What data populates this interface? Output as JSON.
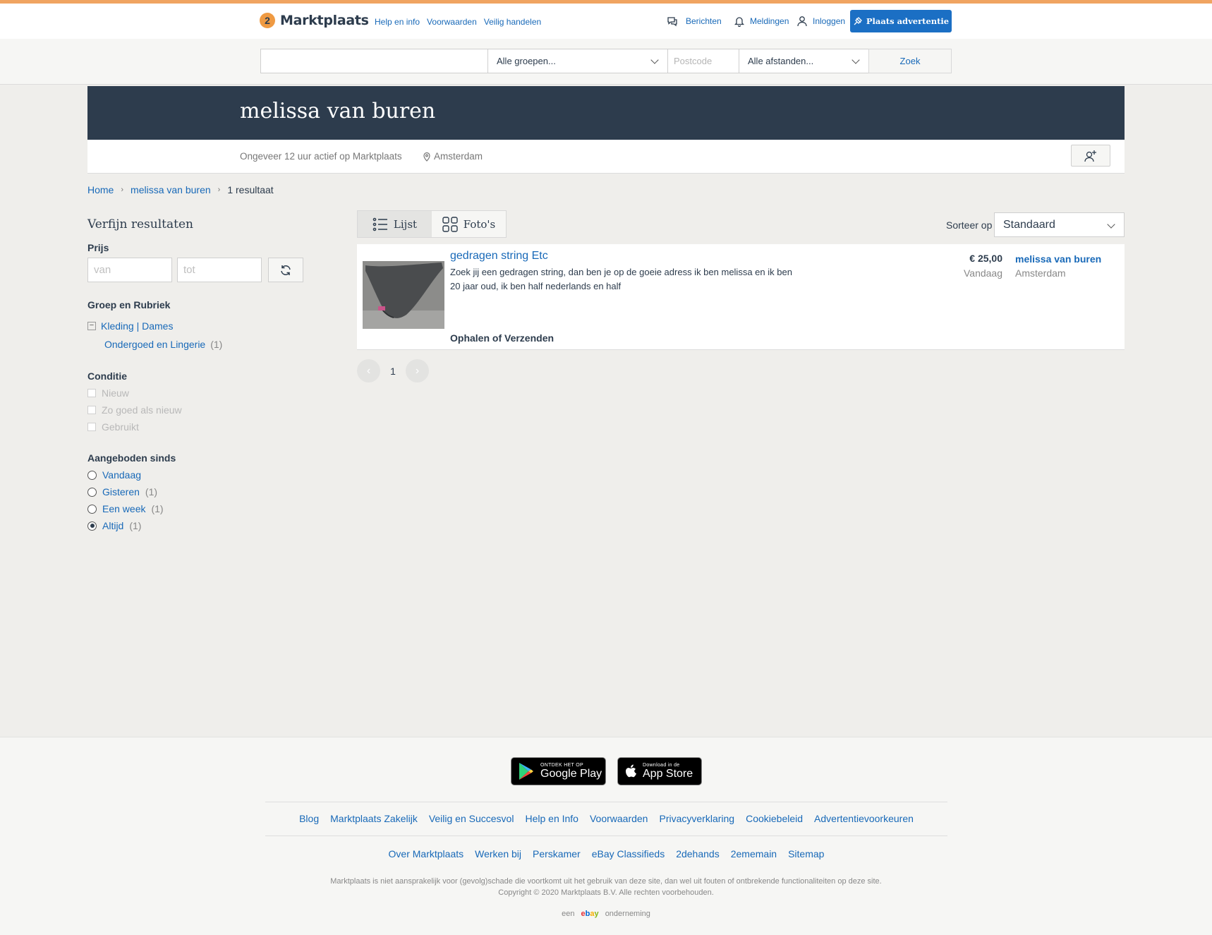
{
  "header": {
    "logo_text": "Marktplaats",
    "nav": [
      "Help en info",
      "Voorwaarden",
      "Veilig handelen"
    ],
    "berichten": "Berichten",
    "meldingen": "Meldingen",
    "inloggen": "Inloggen",
    "plaats": "Plaats advertentie"
  },
  "search": {
    "query": "",
    "group": "Alle groepen...",
    "postcode_placeholder": "Postcode",
    "distance": "Alle afstanden...",
    "submit": "Zoek"
  },
  "profile": {
    "name": "melissa van buren",
    "active": "Ongeveer 12 uur actief op Marktplaats",
    "location": "Amsterdam"
  },
  "breadcrumb": {
    "home": "Home",
    "seller": "melissa van buren",
    "current": "1 resultaat"
  },
  "filters": {
    "title": "Verfijn resultaten",
    "price_label": "Prijs",
    "price_from": "van",
    "price_to": "tot",
    "group_label": "Groep en Rubriek",
    "group_name": "Kleding | Dames",
    "subgroup_name": "Ondergoed en Lingerie",
    "subgroup_count": "(1)",
    "condition_label": "Conditie",
    "conditions": [
      "Nieuw",
      "Zo goed als nieuw",
      "Gebruikt"
    ],
    "since_label": "Aangeboden sinds",
    "since": [
      {
        "label": "Vandaag",
        "count": ""
      },
      {
        "label": "Gisteren",
        "count": "(1)"
      },
      {
        "label": "Een week",
        "count": "(1)"
      },
      {
        "label": "Altijd",
        "count": "(1)"
      }
    ]
  },
  "view": {
    "list": "Lijst",
    "photos": "Foto's",
    "sort_label": "Sorteer op",
    "sort_value": "Standaard"
  },
  "listing": {
    "title": "gedragen string Etc",
    "description": "Zoek jij een gedragen string, dan ben je op de goeie adress  ik ben melissa en ik ben 20 jaar oud, ik ben half nederlands en half",
    "shipping": "Ophalen of Verzenden",
    "price": "€ 25,00",
    "seller": "melissa van buren",
    "date": "Vandaag",
    "city": "Amsterdam"
  },
  "pager": {
    "page": "1"
  },
  "footer": {
    "google_small": "ONTDEK HET OP",
    "google_big": "Google Play",
    "apple_small": "Download in de",
    "apple_big": "App Store",
    "links1": [
      "Blog",
      "Marktplaats Zakelijk",
      "Veilig en Succesvol",
      "Help en Info",
      "Voorwaarden",
      "Privacyverklaring",
      "Cookiebeleid",
      "Advertentievoorkeuren"
    ],
    "links2": [
      "Over Marktplaats",
      "Werken bij",
      "Perskamer",
      "eBay Classifieds",
      "2dehands",
      "2ememain",
      "Sitemap"
    ],
    "disclaimer1": "Marktplaats is niet aansprakelijk voor (gevolg)schade die voortkomt uit het gebruik van deze site, dan wel uit fouten of ontbrekende functionaliteiten op deze site.",
    "disclaimer2": "Copyright © 2020 Marktplaats B.V. Alle rechten voorbehouden.",
    "een": "een",
    "ebay": "ebay",
    "onderneming": "onderneming"
  }
}
